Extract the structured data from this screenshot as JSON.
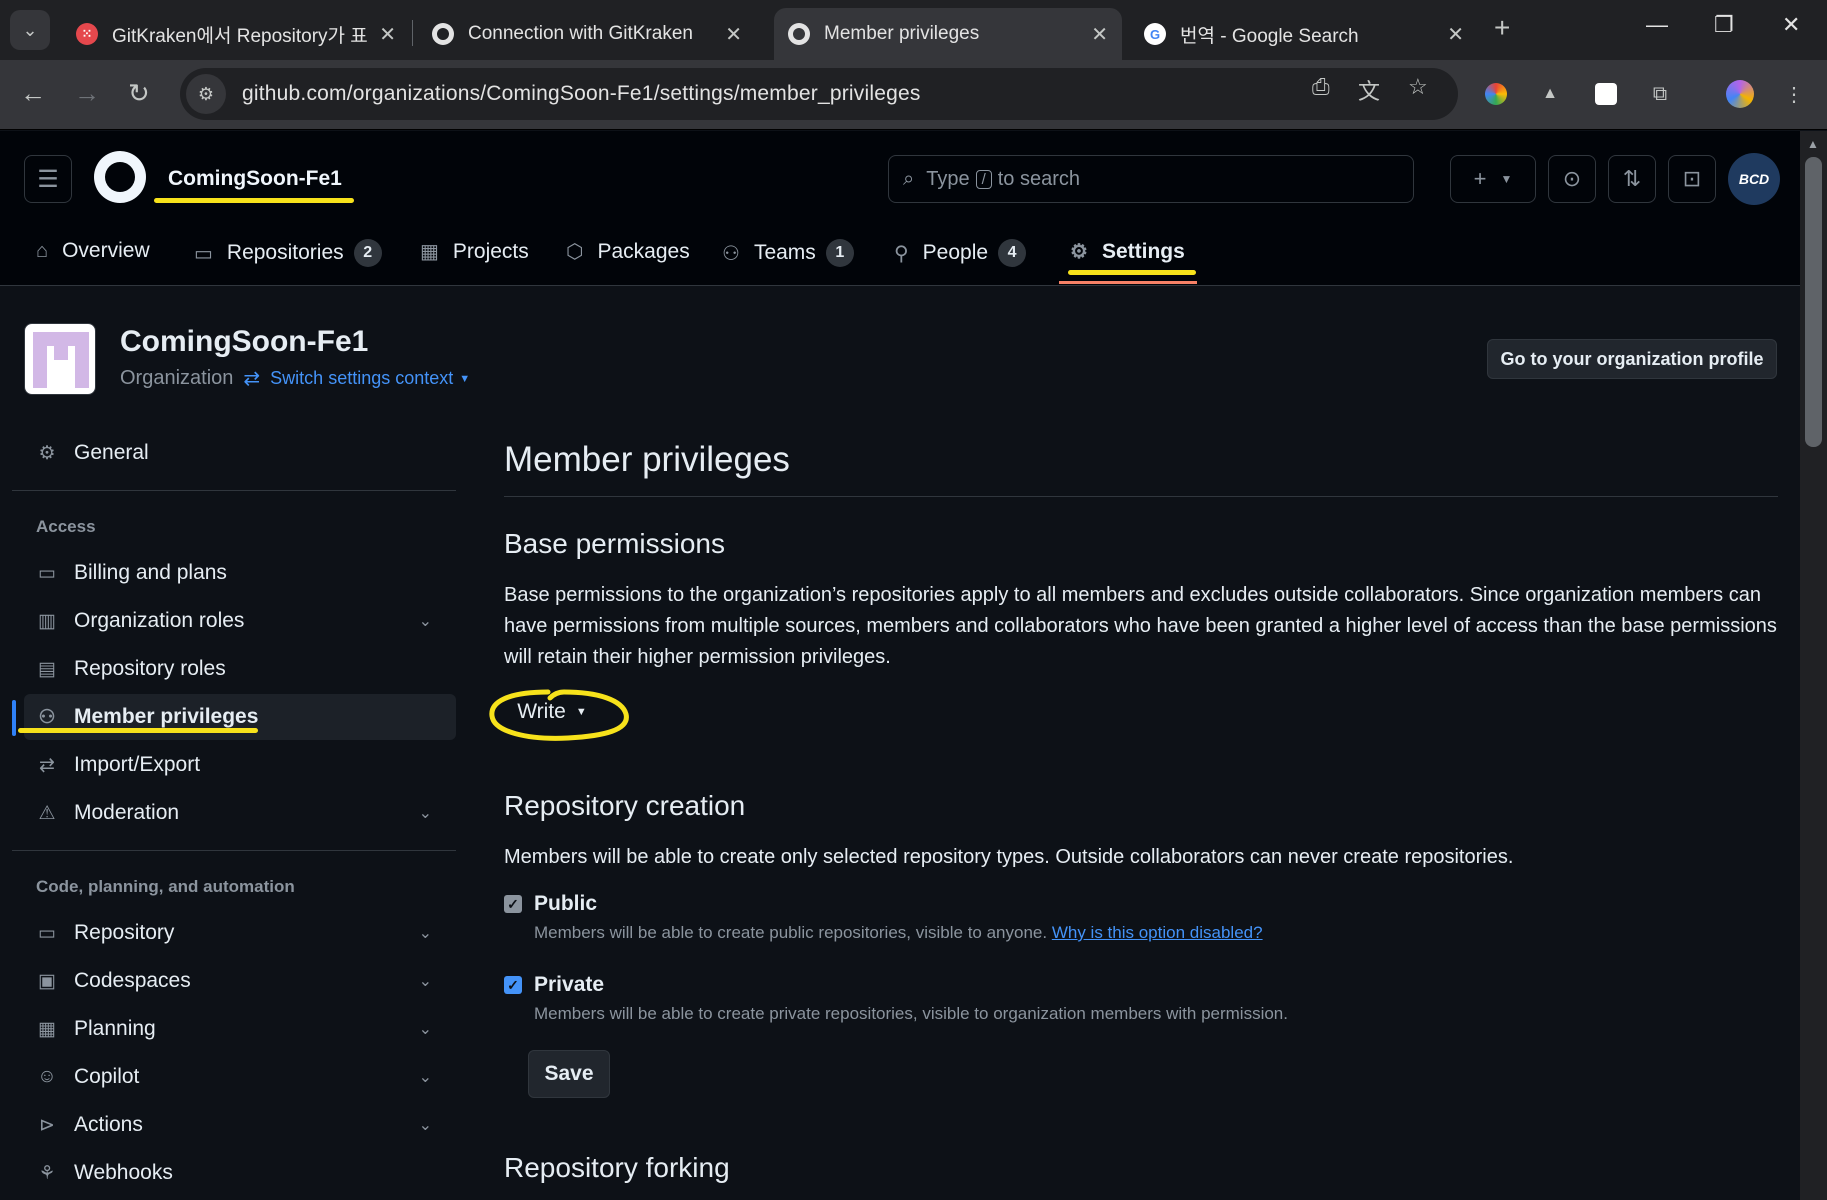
{
  "browser": {
    "tabs": [
      {
        "title": "GitKraken에서 Repository가 표",
        "favicon": "gitkraken-icon",
        "color": "#e5484d"
      },
      {
        "title": "Connection with GitKraken",
        "favicon": "github-icon",
        "color": "#e3e3e3"
      },
      {
        "title": "Member privileges",
        "favicon": "github-icon",
        "color": "#e3e3e3",
        "active": true
      },
      {
        "title": "번역 - Google Search",
        "favicon": "google-icon",
        "color": "#4285f4"
      }
    ],
    "url": "github.com/organizations/ComingSoon-Fe1/settings/member_privileges"
  },
  "header": {
    "org_name": "ComingSoon-Fe1",
    "search_placeholder_pre": "Type",
    "search_key": "/",
    "search_placeholder_post": "to search",
    "avatar_text": "BCD"
  },
  "org_nav": [
    {
      "label": "Overview",
      "icon": "home-icon"
    },
    {
      "label": "Repositories",
      "icon": "repo-icon",
      "count": "2"
    },
    {
      "label": "Projects",
      "icon": "table-icon"
    },
    {
      "label": "Packages",
      "icon": "package-icon"
    },
    {
      "label": "Teams",
      "icon": "people-icon",
      "count": "1"
    },
    {
      "label": "People",
      "icon": "person-icon",
      "count": "4"
    },
    {
      "label": "Settings",
      "icon": "gear-icon",
      "active": true
    }
  ],
  "org": {
    "title": "ComingSoon-Fe1",
    "type": "Organization",
    "switch_label": "Switch settings context",
    "profile_button": "Go to your organization profile"
  },
  "sidebar": {
    "general": "General",
    "access_heading": "Access",
    "access_items": [
      {
        "label": "Billing and plans",
        "icon": "credit-card-icon"
      },
      {
        "label": "Organization roles",
        "icon": "organization-icon",
        "expandable": true
      },
      {
        "label": "Repository roles",
        "icon": "id-badge-icon"
      },
      {
        "label": "Member privileges",
        "icon": "people-icon",
        "active": true
      },
      {
        "label": "Import/Export",
        "icon": "arrow-switch-icon"
      },
      {
        "label": "Moderation",
        "icon": "report-icon",
        "expandable": true
      }
    ],
    "code_heading": "Code, planning, and automation",
    "code_items": [
      {
        "label": "Repository",
        "icon": "repo-icon",
        "expandable": true
      },
      {
        "label": "Codespaces",
        "icon": "codespaces-icon",
        "expandable": true
      },
      {
        "label": "Planning",
        "icon": "table-icon",
        "expandable": true
      },
      {
        "label": "Copilot",
        "icon": "copilot-icon",
        "expandable": true
      },
      {
        "label": "Actions",
        "icon": "play-icon",
        "expandable": true
      },
      {
        "label": "Webhooks",
        "icon": "webhook-icon"
      }
    ]
  },
  "main": {
    "title": "Member privileges",
    "base_permissions": {
      "heading": "Base permissions",
      "description": "Base permissions to the organization’s repositories apply to all members and excludes outside collaborators. Since organization members can have permissions from multiple sources, members and collaborators who have been granted a higher level of access than the base permissions will retain their higher permission privileges.",
      "selected": "Write"
    },
    "repo_creation": {
      "heading": "Repository creation",
      "description": "Members will be able to create only selected repository types. Outside collaborators can never create repositories.",
      "public_label": "Public",
      "public_note": "Members will be able to create public repositories, visible to anyone.",
      "public_link": "Why is this option disabled?",
      "private_label": "Private",
      "private_note": "Members will be able to create private repositories, visible to organization members with permission.",
      "save": "Save"
    },
    "repo_forking": {
      "heading": "Repository forking"
    }
  },
  "colors": {
    "highlight": "#f7e21b",
    "accent": "#4493f8",
    "nav_underline": "#f78166"
  }
}
